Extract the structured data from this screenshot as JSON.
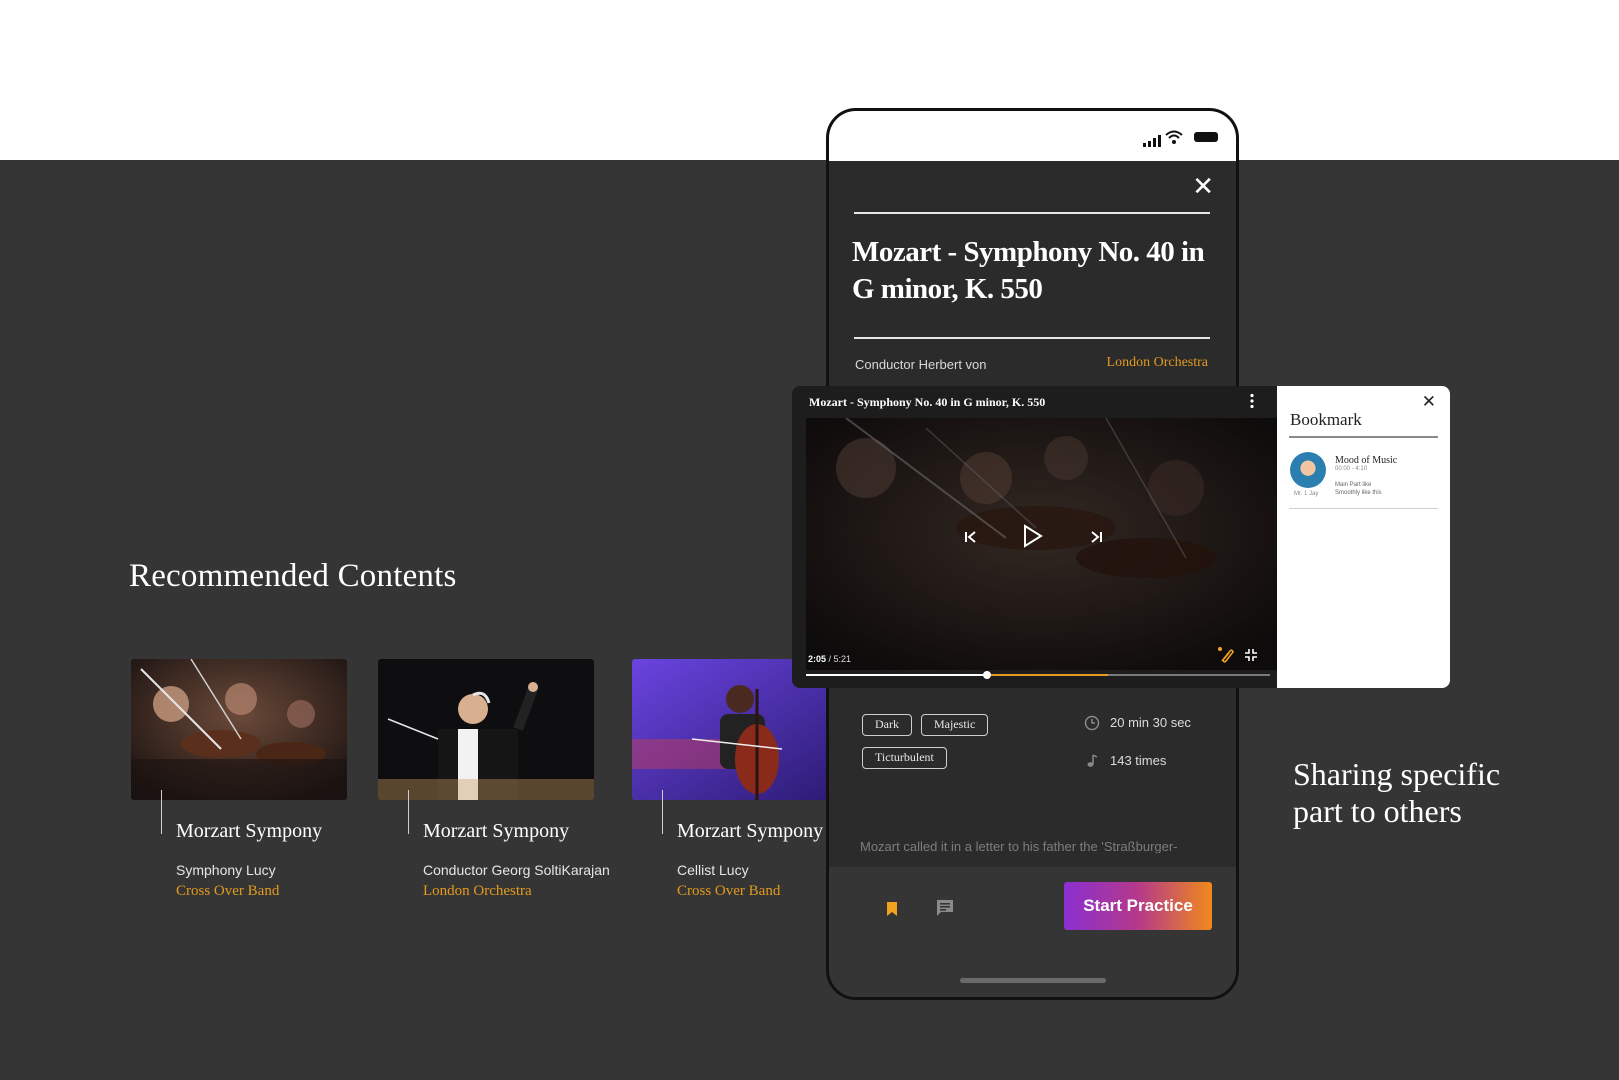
{
  "recommended": {
    "title": "Recommended Contents",
    "cards": [
      {
        "title": "Morzart Sympony",
        "subtitle": "Symphony Lucy",
        "org": "Cross Over Band",
        "image": "orchestra-violins-photo"
      },
      {
        "title": "Morzart Sympony",
        "subtitle": "Conductor  Georg SoltiKarajan",
        "org": "London Orchestra",
        "image": "conductor-photo"
      },
      {
        "title": "Morzart Sympony",
        "subtitle": "Cellist  Lucy",
        "org": "Cross Over Band",
        "image": "cellist-photo"
      }
    ]
  },
  "phone": {
    "close_icon": "close-icon",
    "title": "Mozart - Symphony No. 40 in G minor, K. 550",
    "conductor": "Conductor Herbert von",
    "orchestra": "London Orchestra",
    "tags": [
      "Dark",
      "Majestic",
      "Ticturbulent"
    ],
    "duration": "20 min 30 sec",
    "play_count": "143 times",
    "description": "Mozart called it in a letter to his father the 'Straßburger-",
    "start_button": "Start Practice",
    "icons": {
      "bookmark": "bookmark-icon",
      "chat": "chat-icon"
    }
  },
  "player": {
    "title": "Mozart - Symphony No. 40  in G minor, K. 550",
    "current_time": "2:05",
    "total_time": "5:21",
    "progress": 0.39,
    "segment": {
      "start": 0.39,
      "end": 0.65
    },
    "colors": {
      "segment": "#e39a1e",
      "accent": "#e39a1e"
    }
  },
  "bookmark": {
    "title": "Bookmark",
    "item": {
      "name": "Mood of Music",
      "time": "00:00 - 4:10",
      "user": "Mr. 1 Jay",
      "note1": "Main Part like",
      "note2": "Smoothly like this"
    }
  },
  "sharing_text": "Sharing specific part to others",
  "colors": {
    "background": "#353535",
    "accent": "#e39a1e",
    "button_gradient": [
      "#8b2fd0",
      "#f08a1c"
    ]
  }
}
